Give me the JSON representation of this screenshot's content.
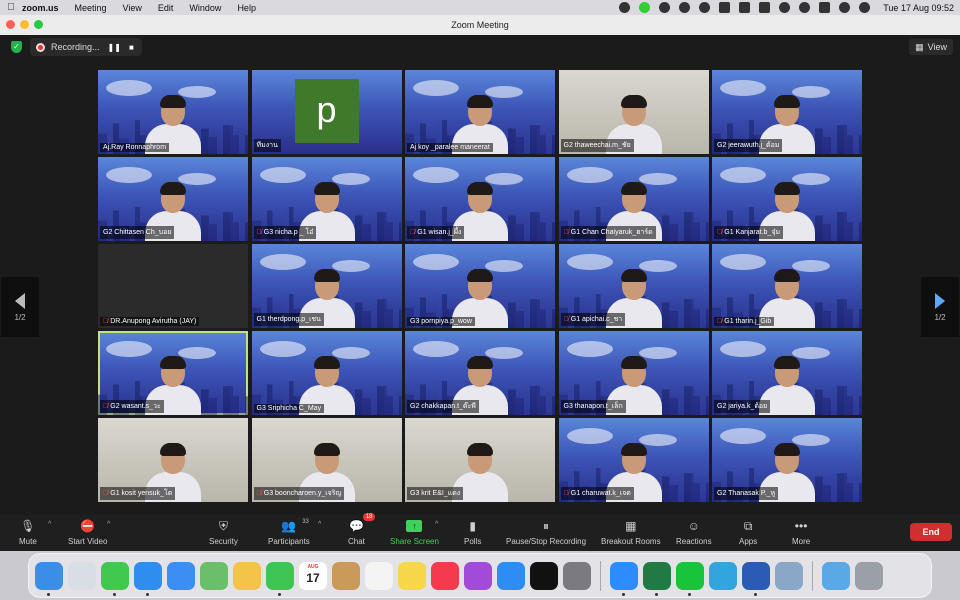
{
  "menubar": {
    "app": "zoom.us",
    "items": [
      "Meeting",
      "View",
      "Edit",
      "Window",
      "Help"
    ],
    "clock": "Tue 17 Aug  09:52"
  },
  "window": {
    "title": "Zoom Meeting"
  },
  "topbar": {
    "recording_label": "Recording...",
    "pause_glyph": "❚❚",
    "stop_glyph": "■",
    "view_label": "View"
  },
  "pager": {
    "left": "1/2",
    "right": "1/2"
  },
  "participants": [
    {
      "name": "Aj.Ray Ronnaphrom",
      "muted": false,
      "kind": "bg"
    },
    {
      "name": "ทีมงาน",
      "muted": false,
      "kind": "avatar",
      "initial": "p"
    },
    {
      "name": "Aj koy _paralee maneerat",
      "muted": false,
      "kind": "bg"
    },
    {
      "name": "G2 thaweechai.m_ชัย",
      "muted": false,
      "kind": "office"
    },
    {
      "name": "G2 jeerawuth.j_ต้อม",
      "muted": false,
      "kind": "bg"
    },
    {
      "name": "G2 Chittasen Ch_บอย",
      "muted": false,
      "kind": "bg"
    },
    {
      "name": "G3 nicha.p _ โอ๋",
      "muted": true,
      "kind": "bg"
    },
    {
      "name": "G1 wisan.j_ผึ้ง",
      "muted": true,
      "kind": "bg"
    },
    {
      "name": "G1 Chan Chaiyaruk_ฮาร์ด",
      "muted": true,
      "kind": "bg"
    },
    {
      "name": "G1 Kanjarat.b_จุ๋ม",
      "muted": true,
      "kind": "bg"
    },
    {
      "name": "DR.Anupong Avirutha (JAY)",
      "muted": true,
      "kind": "dark"
    },
    {
      "name": "G1 therdpong.p_เชน",
      "muted": false,
      "kind": "bg"
    },
    {
      "name": "G3 pornpiya.p_wow",
      "muted": false,
      "kind": "bg"
    },
    {
      "name": "G1 apichai.c_ชา",
      "muted": true,
      "kind": "bg"
    },
    {
      "name": "G1 tharin.j_Gib",
      "muted": true,
      "kind": "bg"
    },
    {
      "name": "G2 wasant.s_วะ",
      "muted": true,
      "kind": "bg",
      "active": true
    },
    {
      "name": "G3 Sriphicha C_May",
      "muted": false,
      "kind": "bg"
    },
    {
      "name": "G2 chakkapan.t_ต๊ะพี",
      "muted": false,
      "kind": "bg"
    },
    {
      "name": "G3 thanapon.t_เล็ก",
      "muted": false,
      "kind": "bg"
    },
    {
      "name": "G2 jariya.k_ต้อย",
      "muted": false,
      "kind": "bg"
    },
    {
      "name": "G1 kosit yensuk_โต",
      "muted": true,
      "kind": "office"
    },
    {
      "name": "G3 booncharoen.y_เจริญ",
      "muted": true,
      "kind": "office"
    },
    {
      "name": "G3 krit E&I_แดง",
      "muted": false,
      "kind": "office"
    },
    {
      "name": "G1 charuwat.k_เจต",
      "muted": true,
      "kind": "bg"
    },
    {
      "name": "G2 Thanasak P._หู",
      "muted": false,
      "kind": "bg"
    }
  ],
  "toolbar": {
    "mute": "Mute",
    "start_video": "Start Video",
    "security": "Security",
    "participants": "Participants",
    "participants_count": "33",
    "chat": "Chat",
    "chat_badge": "18",
    "share_screen": "Share Screen",
    "polls": "Polls",
    "record": "Pause/Stop Recording",
    "breakout": "Breakout Rooms",
    "reactions": "Reactions",
    "apps": "Apps",
    "more": "More",
    "end": "End"
  },
  "dock": {
    "calendar_month": "AUG",
    "calendar_day": "17",
    "apps": [
      {
        "name": "finder-icon",
        "color": "#3b8ee8"
      },
      {
        "name": "launchpad-icon",
        "color": "#d9dde6"
      },
      {
        "name": "messages-icon",
        "color": "#41c84e"
      },
      {
        "name": "safari-icon",
        "color": "#2f8df0"
      },
      {
        "name": "mail-icon",
        "color": "#3a8ef4"
      },
      {
        "name": "maps-icon",
        "color": "#6bbf6a"
      },
      {
        "name": "photos-icon",
        "color": "#f3c34a"
      },
      {
        "name": "facetime-icon",
        "color": "#3ec553"
      },
      {
        "name": "calendar-icon",
        "color": "#ffffff"
      },
      {
        "name": "contacts-icon",
        "color": "#c99a5a"
      },
      {
        "name": "reminders-icon",
        "color": "#f4f4f4"
      },
      {
        "name": "notes-icon",
        "color": "#f7d64a"
      },
      {
        "name": "music-icon",
        "color": "#f53a4f"
      },
      {
        "name": "podcasts-icon",
        "color": "#a24bd8"
      },
      {
        "name": "app-store-icon",
        "color": "#2f8cf2"
      },
      {
        "name": "tv-icon",
        "color": "#111111"
      },
      {
        "name": "system-preferences-icon",
        "color": "#7a7a80"
      },
      {
        "name": "zoom-icon",
        "color": "#2d8cff"
      },
      {
        "name": "excel-icon",
        "color": "#1f7a44"
      },
      {
        "name": "line-icon",
        "color": "#18c43a"
      },
      {
        "name": "telegram-icon",
        "color": "#32a4de"
      },
      {
        "name": "word-icon",
        "color": "#2a5cb5"
      },
      {
        "name": "preview-icon",
        "color": "#8aa7c8"
      },
      {
        "name": "downloads-icon",
        "color": "#5aa9e6"
      },
      {
        "name": "trash-icon",
        "color": "#9aa0a6"
      }
    ]
  }
}
